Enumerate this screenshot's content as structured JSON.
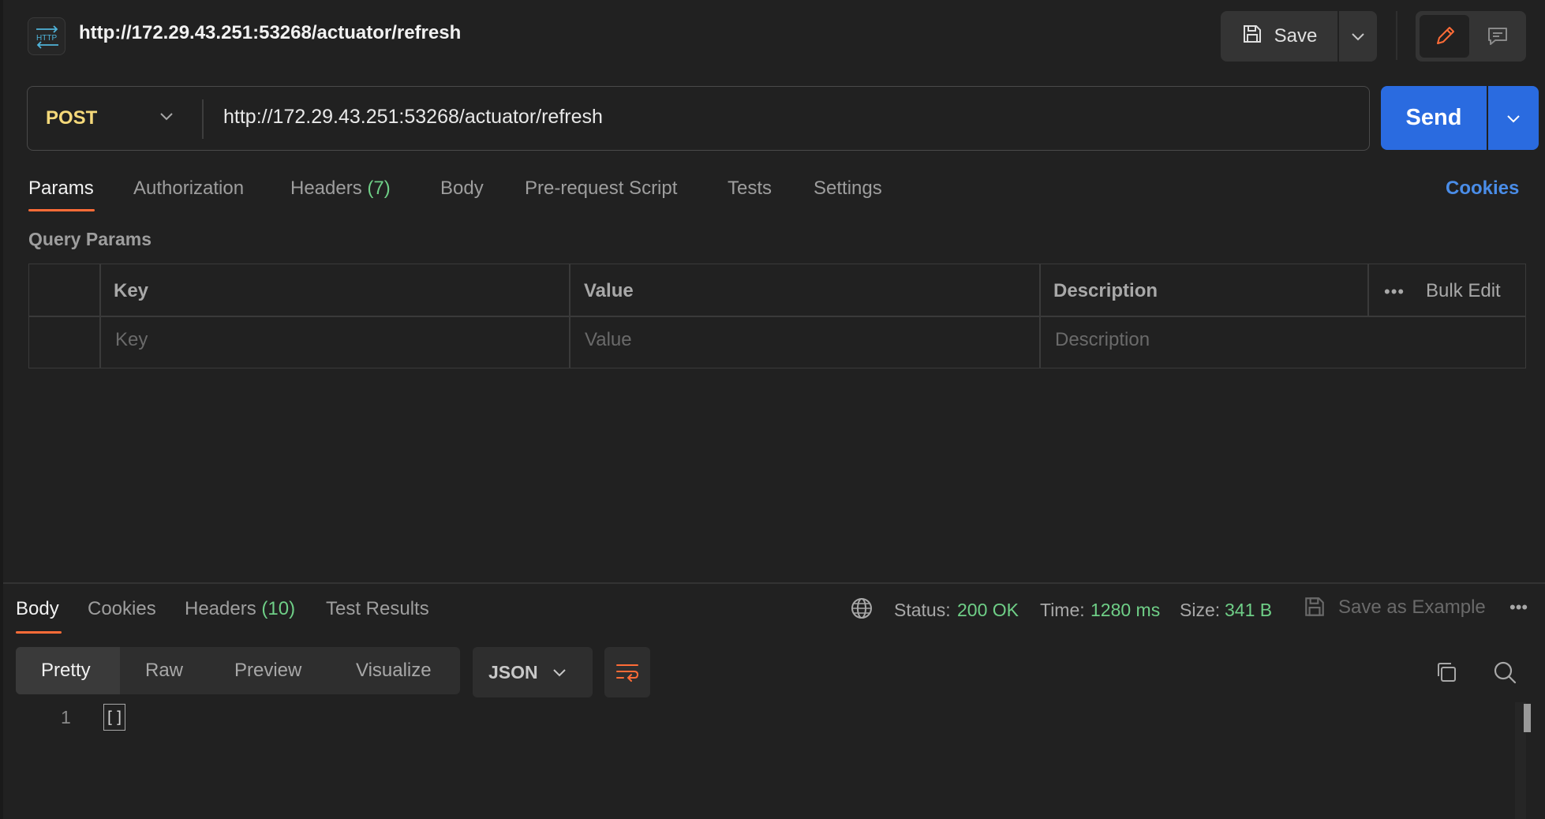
{
  "header": {
    "title": "http://172.29.43.251:53268/actuator/refresh",
    "save_label": "Save"
  },
  "request": {
    "method": "POST",
    "url": "http://172.29.43.251:53268/actuator/refresh",
    "send_label": "Send"
  },
  "request_tabs": {
    "params": "Params",
    "authorization": "Authorization",
    "headers": "Headers",
    "headers_count": "(7)",
    "body": "Body",
    "prerequest": "Pre-request Script",
    "tests": "Tests",
    "settings": "Settings",
    "cookies": "Cookies"
  },
  "query_params": {
    "title": "Query Params",
    "columns": {
      "key": "Key",
      "value": "Value",
      "description": "Description"
    },
    "bulk_edit": "Bulk Edit",
    "placeholders": {
      "key": "Key",
      "value": "Value",
      "description": "Description"
    }
  },
  "response_tabs": {
    "body": "Body",
    "cookies": "Cookies",
    "headers": "Headers",
    "headers_count": "(10)",
    "test_results": "Test Results"
  },
  "response_meta": {
    "status_label": "Status:",
    "status_value": "200 OK",
    "time_label": "Time:",
    "time_value": "1280 ms",
    "size_label": "Size:",
    "size_value": "341 B",
    "save_example": "Save as Example"
  },
  "view_tabs": [
    "Pretty",
    "Raw",
    "Preview",
    "Visualize"
  ],
  "format": "JSON",
  "code": {
    "line_number": "1",
    "content": "[]"
  },
  "colors": {
    "accent": "#ff6c37",
    "send": "#2a6be0",
    "method_post": "#f5d97a",
    "success": "#6fcf87",
    "link": "#4a8de8"
  }
}
